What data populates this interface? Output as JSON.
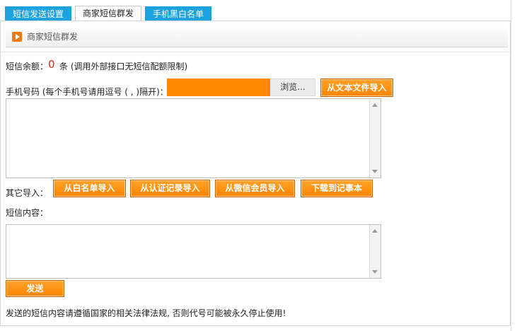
{
  "tabs": [
    {
      "label": "短信发送设置"
    },
    {
      "label": "商家短信群发"
    },
    {
      "label": "手机黑白名单"
    }
  ],
  "panel": {
    "title": "商家短信群发"
  },
  "balance": {
    "label": "短信余额：",
    "value": "0",
    "note": "条 (调用外部接口无短信配额限制)"
  },
  "phone": {
    "label": "手机号码 (每个手机号请用逗号 ( , )隔开)：",
    "browse_label": "浏览...",
    "import_text_label": "从文本文件导入"
  },
  "other_import": {
    "label": "其它导入：",
    "buttons": [
      "从白名单导入",
      "从认证记录导入",
      "从微信会员导入",
      "下载到记事本"
    ]
  },
  "content": {
    "label": "短信内容："
  },
  "send_label": "发送",
  "notice": "发送的短信内容请遵循国家的相关法律法规, 否则代号可能被永久停止使用!"
}
